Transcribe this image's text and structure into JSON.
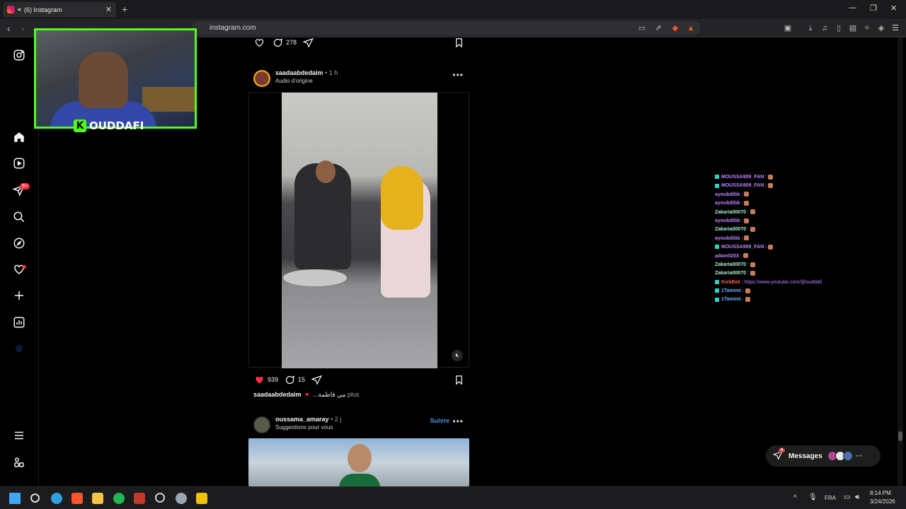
{
  "browser": {
    "tab_title": "(6) Instagram",
    "tab_close": "✕",
    "new_tab": "+",
    "url": "instagram.com",
    "back": "‹",
    "forward": "›",
    "window_controls": {
      "minimize": "—",
      "restore": "❐",
      "close": "✕"
    }
  },
  "webcam": {
    "streamer": "OUDDAFI",
    "platform_letter": "K"
  },
  "nav": {
    "notifications_badge": "9+"
  },
  "feed": {
    "top_post": {
      "comments": "278"
    },
    "post1": {
      "username": "saadaabdedaim",
      "time": "• 1 h",
      "audio": "Audio d'origine",
      "more": "•••",
      "likes": "939",
      "comments": "15",
      "caption_user": "saadaabdedaim",
      "caption_text": "...مي فاطمة",
      "caption_more": "plus"
    },
    "post2": {
      "username": "oussama_amaray",
      "time": "• 2 j",
      "subtitle": "Suggestions pour vous",
      "follow": "Suivre",
      "more": "•••"
    }
  },
  "chat": [
    {
      "user": "MOUSSA909_FAN",
      "color": "#b983ff",
      "badge": true
    },
    {
      "user": "MOUSSA909_FAN",
      "color": "#b983ff",
      "badge": true
    },
    {
      "user": "ayoubdibb",
      "color": "#b983ff",
      "badge": false
    },
    {
      "user": "ayoubdibb",
      "color": "#b983ff",
      "badge": false
    },
    {
      "user": "Zakaria00070",
      "color": "#a7f3d0",
      "badge": false
    },
    {
      "user": "ayoubdibb",
      "color": "#b983ff",
      "badge": false
    },
    {
      "user": "Zakaria00070",
      "color": "#a7f3d0",
      "badge": false
    },
    {
      "user": "ayoubdibb",
      "color": "#b983ff",
      "badge": false
    },
    {
      "user": "MOUSSA909_FAN",
      "color": "#b983ff",
      "badge": true
    },
    {
      "user": "adam0203",
      "color": "#b983ff",
      "badge": false
    },
    {
      "user": "Zakaria00070",
      "color": "#a7f3d0",
      "badge": false
    },
    {
      "user": "Zakaria00070",
      "color": "#a7f3d0",
      "badge": false
    },
    {
      "user": "KickBot",
      "color": "#ff5c5c",
      "badge": true,
      "text": "https://www.youtube.com/@ouddafi"
    },
    {
      "user": "1Tamimi",
      "color": "#6ab0ff",
      "badge": true
    },
    {
      "user": "1Tamimi",
      "color": "#6ab0ff",
      "badge": true
    }
  ],
  "messages": {
    "label": "Messages",
    "badge": "6",
    "more": "···"
  },
  "taskbar": {
    "lang": "FRA",
    "time": "8:14 PM",
    "date": "3/24/2026",
    "chevron": "^"
  },
  "colors": {
    "accent_green": "#53fc18",
    "ig_red": "#ff3040",
    "link_blue": "#4a91e2"
  }
}
